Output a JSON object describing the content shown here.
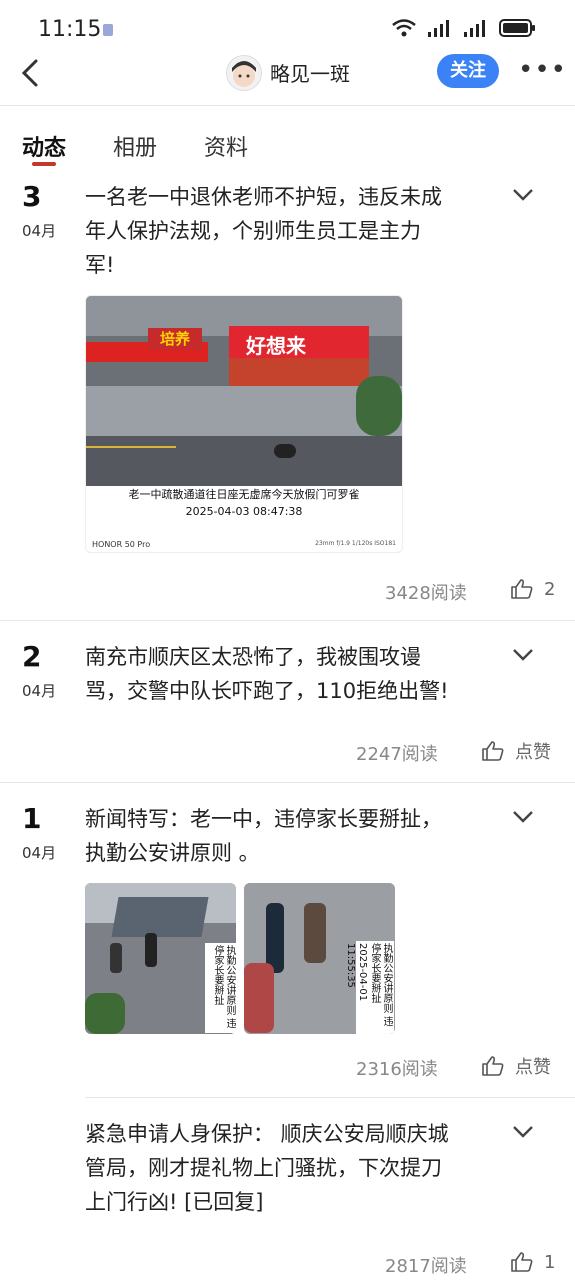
{
  "status": {
    "time": "11:15"
  },
  "header": {
    "nickname": "略见一斑",
    "follow_label": "关注",
    "more": "•••"
  },
  "tabs": [
    {
      "label": "动态"
    },
    {
      "label": "相册"
    },
    {
      "label": "资料"
    }
  ],
  "posts": [
    {
      "day": "3",
      "month": "04月",
      "title_lines": [
        "一名老一中退休老师不护短，违反未成",
        "年人保护法规，个别师生员工是主力",
        "军!"
      ],
      "image": {
        "sign_text": "培养",
        "store_name": "好想来",
        "caption_line1": "老一中疏散通道往日座无虚席今天放假门可罗雀",
        "caption_line2": "2025-04-03  08:47:38",
        "device": "HONOR 50 Pro",
        "exif": "23mm f/1.9 1/120s ISO181"
      },
      "reads": "3428阅读",
      "like": "2"
    },
    {
      "day": "2",
      "month": "04月",
      "title_lines": [
        "南充市顺庆区太恐怖了，我被围攻谩",
        "骂，交警中队长吓跑了，110拒绝出警!"
      ],
      "reads": "2247阅读",
      "like": "点赞"
    },
    {
      "day": "1",
      "month": "04月",
      "title_lines": [
        "新闻特写：老一中，违停家长要掰扯，",
        "执勤公安讲原则 。"
      ],
      "images": [
        {
          "caption": "执勤公安讲原则 违停家长要掰扯"
        },
        {
          "caption": "执勤公安讲原则 违停家长要掰扯",
          "date": "2025-04-01  11:55:35"
        }
      ],
      "reads": "2316阅读",
      "like": "点赞"
    },
    {
      "title_lines": [
        "紧急申请人身保护：  顺庆公安局顺庆城",
        "管局，刚才提礼物上门骚扰，下次提刀",
        "上门行凶!  [已回复]"
      ],
      "reads": "2817阅读",
      "like": "1"
    }
  ]
}
